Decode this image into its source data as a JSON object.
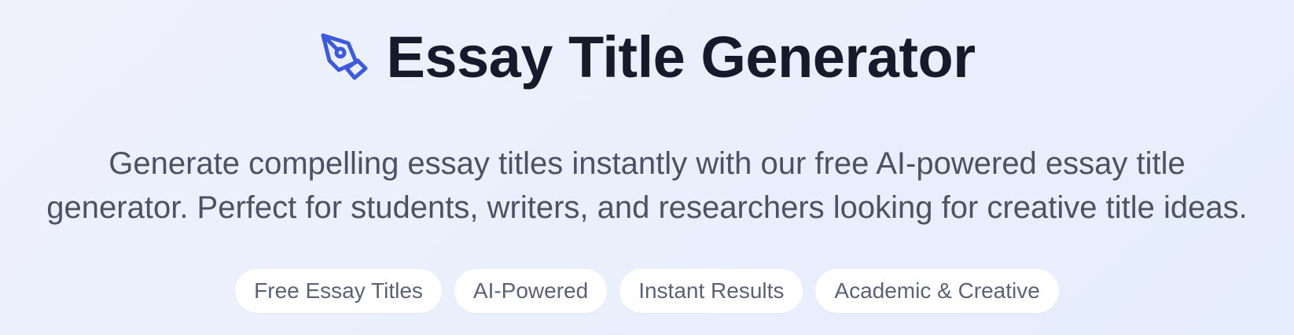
{
  "header": {
    "icon": "pen-nib-icon",
    "title": "Essay Title Generator",
    "description": "Generate compelling essay titles instantly with our free AI-powered essay title generator. Perfect for students, writers, and researchers looking for creative title ideas."
  },
  "badges": [
    {
      "label": "Free Essay Titles"
    },
    {
      "label": "AI-Powered"
    },
    {
      "label": "Instant Results"
    },
    {
      "label": "Academic & Creative"
    }
  ],
  "colors": {
    "accent": "#3b5bdb",
    "title": "#161b2c",
    "text": "#4b5263",
    "badge_bg": "#ffffff",
    "badge_text": "#5b6274",
    "background": "#eaeffc"
  }
}
